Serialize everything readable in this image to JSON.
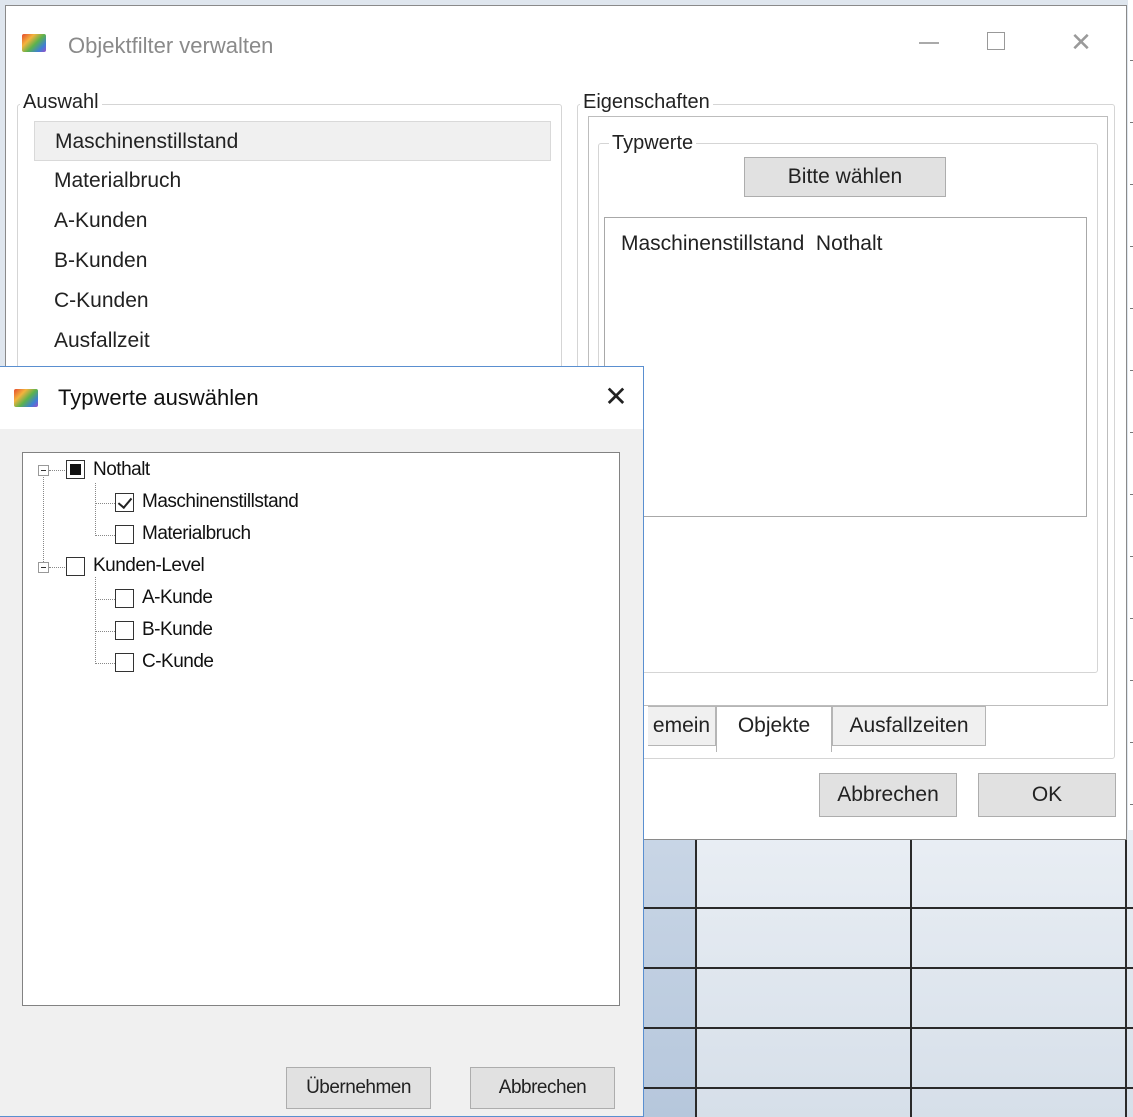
{
  "main_window": {
    "title": "Objektfilter verwalten",
    "controls": {
      "minimize": "—",
      "maximize": "☐",
      "close": "✕"
    },
    "auswahl": {
      "legend": "Auswahl",
      "items": [
        "Maschinenstillstand",
        "Materialbruch",
        "A-Kunden",
        "B-Kunden",
        "C-Kunden",
        "Ausfallzeit"
      ],
      "selected_index": 0
    },
    "eigenschaften": {
      "legend": "Eigenschaften",
      "typwerte": {
        "legend": "Typwerte",
        "choose_button": "Bitte wählen",
        "value_text": "Maschinenstillstand  Nothalt"
      },
      "tabs": [
        "emein",
        "Objekte",
        "Ausfallzeiten"
      ],
      "active_tab": 1
    },
    "buttons": {
      "cancel": "Abbrechen",
      "ok": "OK"
    }
  },
  "dialog": {
    "title": "Typwerte auswählen",
    "close": "✕",
    "tree": [
      {
        "label": "Nothalt",
        "state": "partial",
        "children": [
          {
            "label": "Maschinenstillstand",
            "state": "checked"
          },
          {
            "label": "Materialbruch",
            "state": "unchecked"
          }
        ]
      },
      {
        "label": "Kunden-Level",
        "state": "unchecked",
        "children": [
          {
            "label": "A-Kunde",
            "state": "unchecked"
          },
          {
            "label": "B-Kunde",
            "state": "unchecked"
          },
          {
            "label": "C-Kunde",
            "state": "unchecked"
          }
        ]
      }
    ],
    "buttons": {
      "apply": "Übernehmen",
      "cancel": "Abbrechen"
    }
  }
}
